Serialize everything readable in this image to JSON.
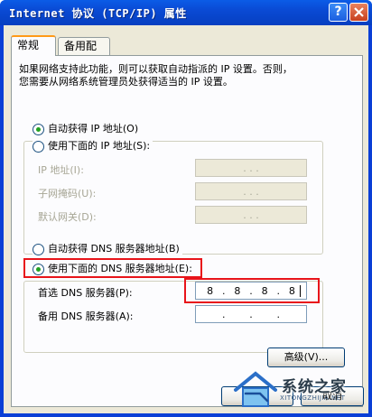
{
  "window": {
    "title": "Internet 协议 (TCP/IP) 属性",
    "help_label": "?",
    "close_label": "✕"
  },
  "tabs": [
    {
      "label": "常规",
      "active": true
    },
    {
      "label": "备用配置",
      "active": false
    }
  ],
  "description": {
    "line1": "如果网络支持此功能，则可以获取自动指派的 IP 设置。否则，",
    "line2": "您需要从网络系统管理员处获得适当的 IP 设置。"
  },
  "ip_section": {
    "auto_label": "自动获得 IP 地址(O)",
    "auto_checked": true,
    "manual_label": "使用下面的 IP 地址(S):",
    "manual_checked": false,
    "fields": [
      {
        "label": "IP 地址(I):",
        "value": ". . ."
      },
      {
        "label": "子网掩码(U):",
        "value": ". . ."
      },
      {
        "label": "默认网关(D):",
        "value": ". . ."
      }
    ]
  },
  "dns_section": {
    "auto_label": "自动获得 DNS 服务器地址(B)",
    "auto_checked": false,
    "manual_label": "使用下面的 DNS 服务器地址(E):",
    "manual_checked": true,
    "preferred_label": "首选 DNS 服务器(P):",
    "preferred_octets": [
      "8",
      "8",
      "8",
      "8"
    ],
    "alternate_label": "备用 DNS 服务器(A):",
    "alternate_octets": [
      "",
      "",
      "",
      ""
    ]
  },
  "buttons": {
    "advanced": "高级(V)...",
    "ok": "确定",
    "cancel": "取消"
  },
  "watermark": {
    "text": "系统之家",
    "sub": "XITONGZHIJIA.NET"
  },
  "colors": {
    "highlight_box": "#e8141a",
    "titlebar": "#0a4ad4"
  }
}
